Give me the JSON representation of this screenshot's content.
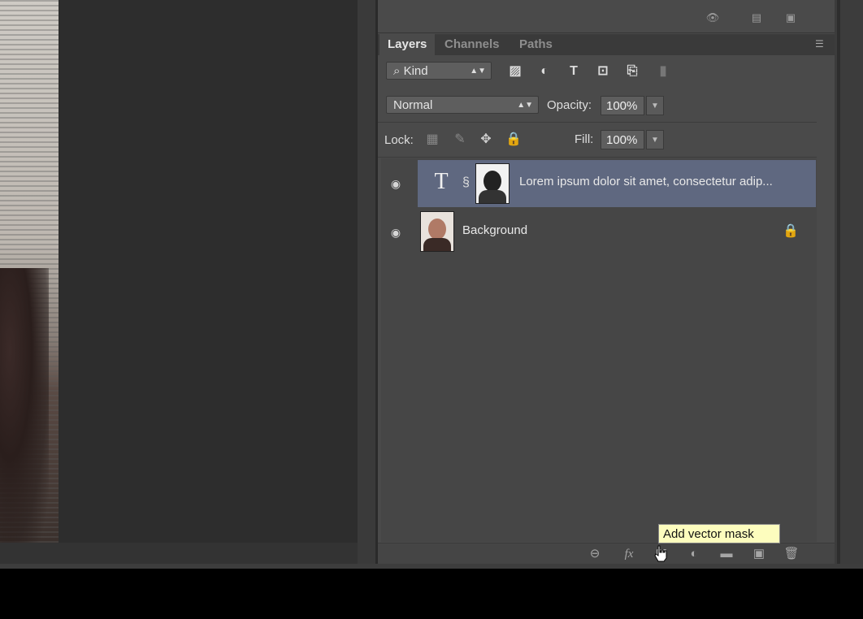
{
  "layers_panel": {
    "tabs": [
      {
        "label": "Layers",
        "active": true
      },
      {
        "label": "Channels",
        "active": false
      },
      {
        "label": "Paths",
        "active": false
      }
    ],
    "filter": {
      "kind_label": "Kind",
      "icons": [
        "image-filter-icon",
        "adjustment-filter-icon",
        "type-filter-icon",
        "shape-filter-icon",
        "smart-object-filter-icon",
        "filter-toggle-icon"
      ]
    },
    "blend_mode": "Normal",
    "opacity_label": "Opacity:",
    "opacity_value": "100%",
    "lock_label": "Lock:",
    "fill_label": "Fill:",
    "fill_value": "100%",
    "layers": [
      {
        "type": "text",
        "name": "Lorem ipsum dolor sit amet, consectetur adip...",
        "visible": true,
        "selected": true
      },
      {
        "type": "image",
        "name": "Background",
        "visible": true,
        "locked": true
      }
    ],
    "footer_icons": [
      "link-layers-icon",
      "fx-icon",
      "add-mask-icon",
      "adjustment-layer-icon",
      "new-group-icon",
      "new-layer-icon",
      "delete-layer-icon"
    ],
    "fx_label": "fx"
  },
  "tooltip": "Add vector mask",
  "colors": {
    "panel_bg": "#4a4a4a",
    "selected_layer": "#5f6880",
    "tooltip_bg": "#fdfdbe"
  }
}
